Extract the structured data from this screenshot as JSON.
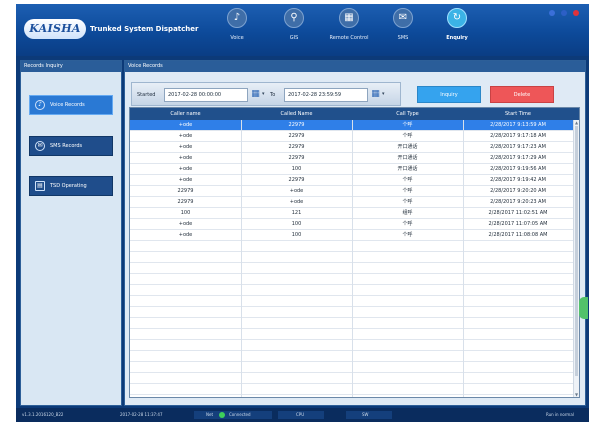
{
  "header": {
    "logo": "KAISHA",
    "title": "Trunked System Dispatcher",
    "nav": [
      {
        "label": "Voice",
        "icon": "microphone-icon",
        "glyph": "♪"
      },
      {
        "label": "GIS",
        "icon": "map-pin-icon",
        "glyph": "⚲"
      },
      {
        "label": "Remote Control",
        "icon": "radio-tower-icon",
        "glyph": "▦"
      },
      {
        "label": "SMS",
        "icon": "message-icon",
        "glyph": "✉"
      },
      {
        "label": "Enquiry",
        "icon": "history-icon",
        "glyph": "↻"
      }
    ],
    "active_nav": "Enquiry",
    "window_dots": [
      "#3a6fd8",
      "#2c5fc6",
      "#e0323a"
    ]
  },
  "left_panel": {
    "title": "Records Inquiry",
    "buttons": [
      {
        "label": "Voice Records",
        "icon": "microphone-icon",
        "glyph": "♪"
      },
      {
        "label": "SMS Records",
        "icon": "message-icon",
        "glyph": "✉"
      },
      {
        "label": "TSD Operating",
        "icon": "log-icon",
        "glyph": "▤"
      }
    ]
  },
  "right_panel": {
    "title": "Voice Records",
    "filter": {
      "start_label": "Started",
      "start_value": "2017-02-28 00:00:00",
      "to_label": "To",
      "end_value": "2017-02-28 23:59:59"
    },
    "inquiry_label": "Inquiry",
    "delete_label": "Delete",
    "table": {
      "columns": [
        "Caller name",
        "Called Name",
        "Call Type",
        "Start Time"
      ],
      "rows": [
        [
          "+ode",
          "22979",
          "个呼",
          "2/28/2017 9:13:59 AM"
        ],
        [
          "+ode",
          "22979",
          "个呼",
          "2/28/2017 9:17:18 AM"
        ],
        [
          "+ode",
          "22979",
          "开口通话",
          "2/28/2017 9:17:23 AM"
        ],
        [
          "+ode",
          "22979",
          "开口通话",
          "2/28/2017 9:17:29 AM"
        ],
        [
          "+ode",
          "100",
          "开口通话",
          "2/28/2017 9:19:56 AM"
        ],
        [
          "+ode",
          "22979",
          "个呼",
          "2/28/2017 9:19:42 AM"
        ],
        [
          "22979",
          "+ode",
          "个呼",
          "2/28/2017 9:20:20 AM"
        ],
        [
          "22979",
          "+ode",
          "个呼",
          "2/28/2017 9:20:23 AM"
        ],
        [
          "100",
          "121",
          "组呼",
          "2/28/2017 11:02:51 AM"
        ],
        [
          "+ode",
          "100",
          "个呼",
          "2/28/2017 11:07:05 AM"
        ],
        [
          "+ode",
          "100",
          "个呼",
          "2/28/2017 11:08:08 AM"
        ]
      ],
      "selected_row": 0,
      "empty_rows": 14
    }
  },
  "status_bar": {
    "version": "v1.3.1.2016120_B22",
    "datetime": "2017-02-28 11:37:47",
    "net_label": "Net",
    "connected_label": "Connected",
    "sip_label": "CPU",
    "sw_label": "SW",
    "right_text": "Run in normal"
  }
}
